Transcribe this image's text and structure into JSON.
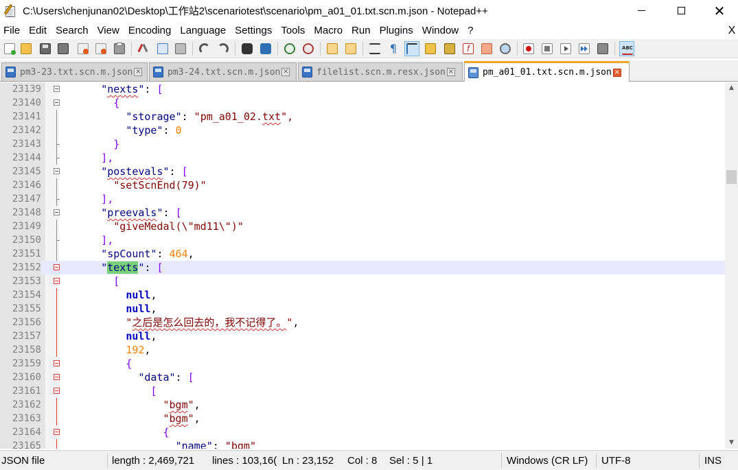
{
  "window": {
    "title": "C:\\Users\\chenjunan02\\Desktop\\工作站2\\scenariotest\\scenario\\pm_a01_01.txt.scn.m.json - Notepad++"
  },
  "menu": {
    "items": [
      "File",
      "Edit",
      "Search",
      "View",
      "Encoding",
      "Language",
      "Settings",
      "Tools",
      "Macro",
      "Run",
      "Plugins",
      "Window",
      "?"
    ],
    "close_label": "X"
  },
  "toolbar": {
    "icons": [
      "new-file-icon",
      "open-file-icon",
      "save-icon",
      "save-all-icon",
      "close-icon",
      "close-all-icon",
      "print-icon",
      "cut-icon",
      "copy-icon",
      "paste-icon",
      "undo-icon",
      "redo-icon",
      "find-icon",
      "replace-icon",
      "zoom-in-icon",
      "zoom-out-icon",
      "sync-vertical-icon",
      "sync-horizontal-icon",
      "word-wrap-icon",
      "show-all-chars-icon",
      "indent-guide-icon",
      "doc-map-icon",
      "function-list-icon",
      "folder-workspace-icon",
      "monitoring-icon",
      "record-macro-icon",
      "stop-macro-icon",
      "play-macro-icon",
      "run-macro-multiple-icon",
      "save-macro-icon",
      "spell-check-icon"
    ],
    "spell_label": "ABC"
  },
  "tabs": [
    {
      "label": "pm3-23.txt.scn.m.json",
      "active": false
    },
    {
      "label": "pm3-24.txt.scn.m.json",
      "active": false
    },
    {
      "label": "filelist.scn.m.resx.json",
      "active": false
    },
    {
      "label": "pm_a01_01.txt.scn.m.json",
      "active": true
    }
  ],
  "editor": {
    "lines": [
      {
        "num": "23139",
        "fold": "box"
      },
      {
        "num": "23140",
        "fold": "box"
      },
      {
        "num": "23141",
        "fold": "line"
      },
      {
        "num": "23142",
        "fold": "line"
      },
      {
        "num": "23143",
        "fold": "end"
      },
      {
        "num": "23144",
        "fold": "end"
      },
      {
        "num": "23145",
        "fold": "box"
      },
      {
        "num": "23146",
        "fold": "line"
      },
      {
        "num": "23147",
        "fold": "end"
      },
      {
        "num": "23148",
        "fold": "box"
      },
      {
        "num": "23149",
        "fold": "line"
      },
      {
        "num": "23150",
        "fold": "end"
      },
      {
        "num": "23151",
        "fold": "line"
      },
      {
        "num": "23152",
        "fold": "box-red"
      },
      {
        "num": "23153",
        "fold": "box-red"
      },
      {
        "num": "23154",
        "fold": "line-red"
      },
      {
        "num": "23155",
        "fold": "line-red"
      },
      {
        "num": "23156",
        "fold": "line-red"
      },
      {
        "num": "23157",
        "fold": "line-red"
      },
      {
        "num": "23158",
        "fold": "line-red"
      },
      {
        "num": "23159",
        "fold": "box-red"
      },
      {
        "num": "23160",
        "fold": "box-red"
      },
      {
        "num": "23161",
        "fold": "box-red"
      },
      {
        "num": "23162",
        "fold": "line-red"
      },
      {
        "num": "23163",
        "fold": "line-red"
      },
      {
        "num": "23164",
        "fold": "box-red"
      },
      {
        "num": "23165",
        "fold": "line-red"
      }
    ],
    "tokens": {
      "t0a": "nexts",
      "t0b": ": ",
      "t1": "{",
      "t2a": "storage",
      "t2b": ": ",
      "t2c": "pm_a01_02.",
      "t2d": "txt",
      "t2e": "\",",
      "t3a": "type",
      "t3b": ": ",
      "t3c": "0",
      "t4": "}",
      "t5": "],",
      "t6a": "postevals",
      "t6b": ": ",
      "t7": "\"setScnEnd(79)\"",
      "t8": "],",
      "t9a": "preevals",
      "t9b": ": ",
      "t10": "\"giveMedal(\\\"md11\\\")\"",
      "t11": "],",
      "t12a": "spCount",
      "t12b": ": ",
      "t12c": "464",
      "t12d": ",",
      "t13a": "texts",
      "t13b": ": ",
      "t14": "[",
      "t15": "null",
      "t16": "null",
      "t17": "之后是怎么回去的，我不记得了。",
      "t18": "null",
      "t19": "192",
      "t20": "{",
      "t21a": "data",
      "t21b": ": ",
      "t22": "[",
      "t23": "bgm",
      "t24": "bgm",
      "t25": "{",
      "t26a": "name",
      "t26b": ": ",
      "t26c": "bgm"
    }
  },
  "status": {
    "file_type": "JSON file",
    "length": "length : 2,469,721",
    "lines": "lines : 103,16(",
    "ln": "Ln : 23,152",
    "col": "Col : 8",
    "sel": "Sel : 5 | 1",
    "eol": "Windows (CR LF)",
    "encoding": "UTF-8",
    "mode": "INS"
  }
}
